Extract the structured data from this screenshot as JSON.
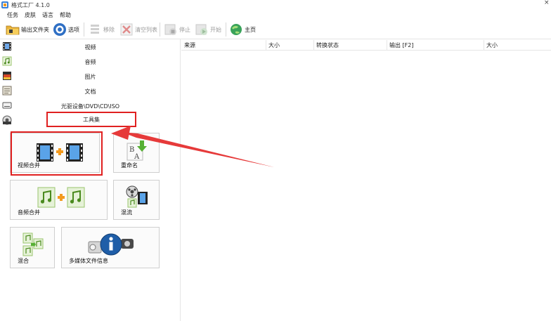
{
  "window": {
    "title": "格式工厂 4.1.0",
    "close_glyph": "×"
  },
  "menu": [
    {
      "label": "任务"
    },
    {
      "label": "皮肤"
    },
    {
      "label": "语言"
    },
    {
      "label": "帮助"
    }
  ],
  "toolbar": {
    "output_folder": "输出文件夹",
    "options": "选项",
    "remove": "移除",
    "clear_list": "清空列表",
    "stop": "停止",
    "start": "开始",
    "home": "主页"
  },
  "categories": [
    {
      "label": "视频",
      "icon": "film-icon"
    },
    {
      "label": "音频",
      "icon": "music-note-icon"
    },
    {
      "label": "图片",
      "icon": "picture-icon"
    },
    {
      "label": "文档",
      "icon": "document-icon"
    },
    {
      "label": "光驱设备\\DVD\\CD\\ISO",
      "icon": "disc-drive-icon"
    },
    {
      "label": "工具集",
      "icon": "toolbox-icon"
    }
  ],
  "tools": {
    "video_merge": "视频合并",
    "rename": "重命名",
    "audio_merge": "音频合并",
    "remux": "混流",
    "mix": "混合",
    "media_info": "多媒体文件信息"
  },
  "columns": [
    "来源",
    "大小",
    "转换状态",
    "输出 [F2]",
    "大小"
  ],
  "colors": {
    "highlight": "#e02020",
    "accent_green": "#7cbf2a",
    "accent_orange": "#f39a1e",
    "info_blue": "#1f5ea8"
  }
}
